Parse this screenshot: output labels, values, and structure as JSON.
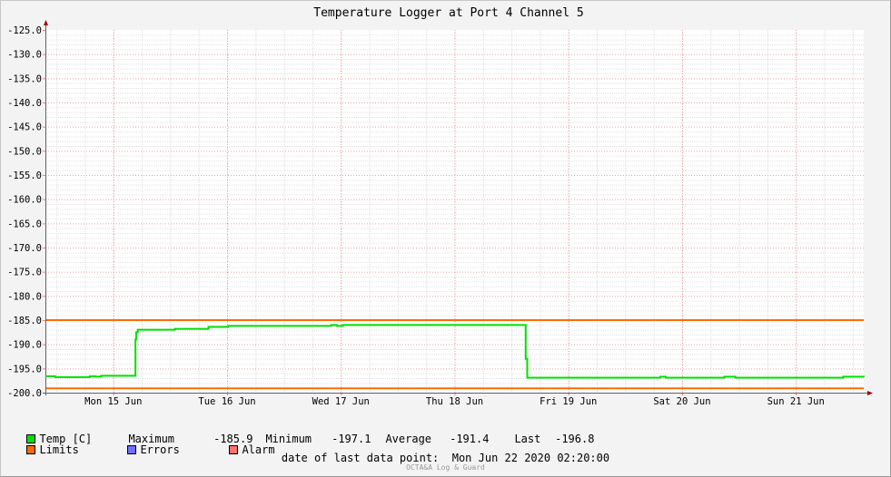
{
  "chart_data": {
    "type": "line",
    "title": "Temperature Logger at Port 4 Channel 5",
    "ylim": [
      -200,
      -125
    ],
    "y_ticks": [
      "-125.0",
      "-130.0",
      "-135.0",
      "-140.0",
      "-145.0",
      "-150.0",
      "-155.0",
      "-160.0",
      "-165.0",
      "-170.0",
      "-175.0",
      "-180.0",
      "-185.0",
      "-190.0",
      "-195.0",
      "-200.0"
    ],
    "x_range": [
      "2020-06-14T21:40:00",
      "2020-06-22T02:20:00"
    ],
    "x_ticks": [
      {
        "date": "2020-06-15T12:00:00",
        "label": "Mon 15 Jun"
      },
      {
        "date": "2020-06-16T12:00:00",
        "label": "Tue 16 Jun"
      },
      {
        "date": "2020-06-17T12:00:00",
        "label": "Wed 17 Jun"
      },
      {
        "date": "2020-06-18T12:00:00",
        "label": "Thu 18 Jun"
      },
      {
        "date": "2020-06-19T12:00:00",
        "label": "Fri 19 Jun"
      },
      {
        "date": "2020-06-20T12:00:00",
        "label": "Sat 20 Jun"
      },
      {
        "date": "2020-06-21T12:00:00",
        "label": "Sun 21 Jun"
      }
    ],
    "grid": true,
    "series": [
      {
        "name": "Temp [C]",
        "color": "#00e000",
        "step": true,
        "points": [
          {
            "x": "2020-06-14T21:40:00",
            "y": -196.6
          },
          {
            "x": "2020-06-14T23:45:00",
            "y": -196.8
          },
          {
            "x": "2020-06-15T07:05:00",
            "y": -196.6
          },
          {
            "x": "2020-06-15T08:15:00",
            "y": -196.7
          },
          {
            "x": "2020-06-15T09:25:00",
            "y": -196.5
          },
          {
            "x": "2020-06-15T16:40:00",
            "y": -189.0
          },
          {
            "x": "2020-06-15T16:50:00",
            "y": -187.5
          },
          {
            "x": "2020-06-15T17:10:00",
            "y": -187.0
          },
          {
            "x": "2020-06-16T01:00:00",
            "y": -186.8
          },
          {
            "x": "2020-06-16T08:05:00",
            "y": -186.4
          },
          {
            "x": "2020-06-16T12:15:00",
            "y": -186.2
          },
          {
            "x": "2020-06-17T10:00:00",
            "y": -186.0
          },
          {
            "x": "2020-06-17T11:10:00",
            "y": -186.2
          },
          {
            "x": "2020-06-17T12:25:00",
            "y": -186.0
          },
          {
            "x": "2020-06-19T03:00:00",
            "y": -193.0
          },
          {
            "x": "2020-06-19T03:20:00",
            "y": -196.9
          },
          {
            "x": "2020-06-20T07:25:00",
            "y": -196.7
          },
          {
            "x": "2020-06-20T08:35:00",
            "y": -196.9
          },
          {
            "x": "2020-06-20T20:55:00",
            "y": -196.7
          },
          {
            "x": "2020-06-20T23:15:00",
            "y": -196.9
          },
          {
            "x": "2020-06-21T22:00:00",
            "y": -196.7
          },
          {
            "x": "2020-06-22T02:20:00",
            "y": -196.8
          }
        ]
      },
      {
        "name": "Limits",
        "color": "#ff6a00",
        "hlines": [
          -185.0,
          -199.1
        ]
      }
    ]
  },
  "legend": {
    "temp": {
      "label": "Temp [C]",
      "color": "#00e000"
    },
    "limits": {
      "label": "Limits",
      "color": "#ff6a00"
    },
    "errors": {
      "label": "Errors",
      "color": "#7070ff"
    },
    "alarm": {
      "label": "Alarm",
      "color": "#ff7070"
    }
  },
  "stats": {
    "max_label": "Maximum",
    "max_value": "-185.9",
    "min_label": "Minimum",
    "min_value": "-197.1",
    "avg_label": "Average",
    "avg_value": "-191.4",
    "last_label": "Last",
    "last_value": "-196.8"
  },
  "footer": {
    "label": "date of last data point:",
    "value": "Mon Jun 22 2020 02:20:00"
  },
  "credit": "OCTA&A Log & Guard"
}
